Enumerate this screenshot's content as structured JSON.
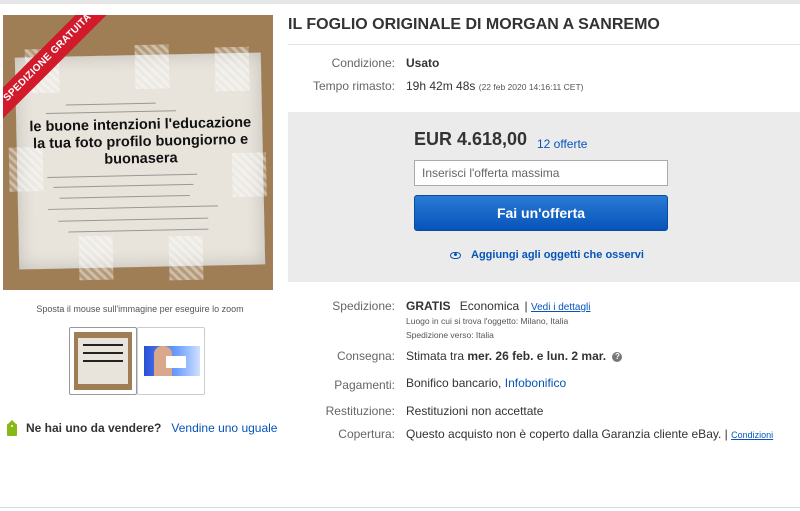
{
  "image": {
    "ribbon": "SPEDIZIONE GRATUITA",
    "paper_text": "le buone intenzioni l'educazione la tua foto profilo buongiorno e buonasera"
  },
  "zoom_hint": "Sposta il mouse sull'immagine per eseguire lo zoom",
  "sell": {
    "question": "Ne hai uno da vendere?",
    "link": "Vendine uno uguale"
  },
  "title": "IL FOGLIO ORIGINALE DI MORGAN A SANREMO",
  "condition": {
    "label": "Condizione:",
    "value": "Usato"
  },
  "time_left": {
    "label": "Tempo rimasto:",
    "value": "19h 42m 48s",
    "date": "(22 feb 2020   14:16:11 CET)"
  },
  "bid": {
    "price": "EUR 4.618,00",
    "offers": "12 offerte",
    "input_placeholder": "Inserisci l'offerta massima",
    "button": "Fai un'offerta",
    "watch": "Aggiungi agli oggetti che osservi"
  },
  "shipping": {
    "label": "Spedizione:",
    "free": "GRATIS",
    "type": "Economica",
    "separator": "|",
    "details_link": "Vedi i dettagli",
    "location": "Luogo in cui si trova l'oggetto:  Milano, Italia",
    "ships_to": "Spedizione verso:  Italia"
  },
  "delivery": {
    "label": "Consegna:",
    "prefix": "Stimata tra",
    "dates": "mer. 26 feb. e lun. 2 mar."
  },
  "payments": {
    "label": "Pagamenti:",
    "value": "Bonifico bancario,",
    "link": "Infobonifico"
  },
  "returns": {
    "label": "Restituzione:",
    "value": "Restituzioni non accettate"
  },
  "coverage": {
    "label": "Copertura:",
    "value": "Questo acquisto non è coperto dalla Garanzia cliente eBay. |",
    "link": "Condizioni"
  },
  "colors": {
    "link": "#0654ba",
    "button": "#0654ba",
    "ribbon": "#d11a2a",
    "bid_box": "#ebebeb"
  }
}
